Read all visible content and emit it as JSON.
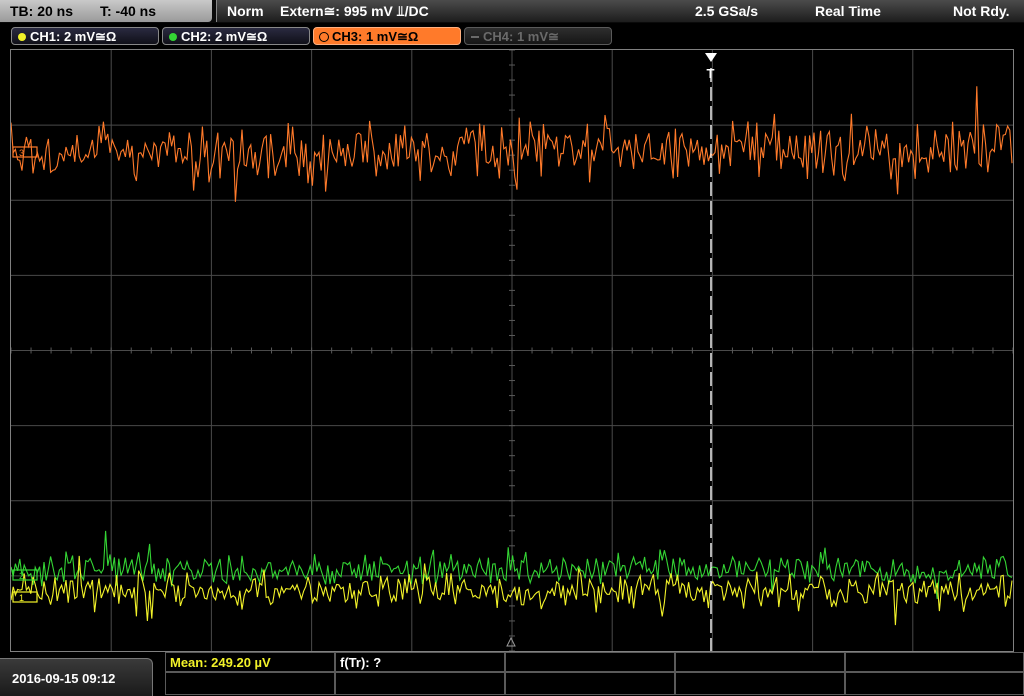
{
  "topbar": {
    "timebase": "TB: 20 ns",
    "trigger_time": "T: -40 ns",
    "trigger_mode": "Norm",
    "trigger_source": "Extern≅: 995 mV ⫫/DC",
    "sample_rate": "2.5 GSa/s",
    "acq_mode": "Real Time",
    "status": "Not Rdy."
  },
  "channels": [
    {
      "label": "CH1: 2 mV≅Ω",
      "color": "#f2f229",
      "active": false,
      "enabled": true
    },
    {
      "label": "CH2: 2 mV≅Ω",
      "color": "#34d534",
      "active": false,
      "enabled": true
    },
    {
      "label": "CH3: 1 mV≅Ω",
      "color": "#ff7a2a",
      "active": true,
      "enabled": true
    },
    {
      "label": "CH4: 1 mV≅",
      "color": "#6a6a6a",
      "active": false,
      "enabled": false
    }
  ],
  "markers": {
    "ch3": "3",
    "ch2": "2",
    "ch1": "1",
    "trigger": "T"
  },
  "bottombar": {
    "datetime": "2016-09-15 09:12",
    "mean_label": "Mean: 249.20 µV",
    "freq_label": "f(Tr): ?"
  },
  "colors": {
    "ch1": "#f2f229",
    "ch2": "#34d534",
    "ch3": "#ff7a2a",
    "grid": "#4a4a4a",
    "background": "#000000"
  }
}
